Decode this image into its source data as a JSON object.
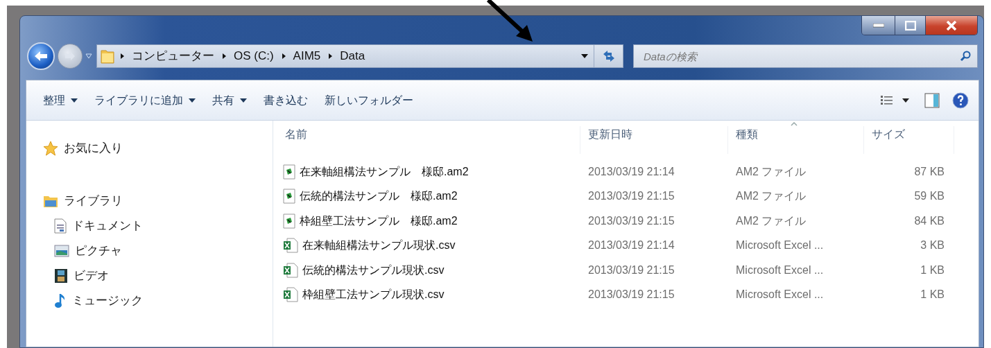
{
  "window_controls": [
    {
      "kind": "minimize"
    },
    {
      "kind": "maximize"
    },
    {
      "kind": "close"
    }
  ],
  "address_bar": {
    "crumbs": [
      "コンピューター",
      "OS (C:)",
      "AIM5",
      "Data"
    ]
  },
  "search": {
    "placeholder": "Dataの検索"
  },
  "toolbar": [
    {
      "label": "整理",
      "dropdown": true
    },
    {
      "label": "ライブラリに追加",
      "dropdown": true
    },
    {
      "label": "共有",
      "dropdown": true
    },
    {
      "label": "書き込む",
      "dropdown": false
    },
    {
      "label": "新しいフォルダー",
      "dropdown": false
    }
  ],
  "sidebar": [
    {
      "label": "お気に入り"
    },
    {
      "label": "ライブラリ",
      "children": [
        {
          "label": "ドキュメント"
        },
        {
          "label": "ピクチャ"
        },
        {
          "label": "ビデオ"
        },
        {
          "label": "ミュージック"
        }
      ]
    }
  ],
  "columns": [
    {
      "label": "名前",
      "sorted": false
    },
    {
      "label": "更新日時",
      "sorted": false
    },
    {
      "label": "種類",
      "sorted": true
    },
    {
      "label": "サイズ",
      "sorted": false
    }
  ],
  "rows": [
    {
      "kind": "am2",
      "name": "在来軸組構法サンプル　様邸.am2",
      "modified": "2013/03/19 21:14",
      "type": "AM2 ファイル",
      "size": "87 KB"
    },
    {
      "kind": "am2",
      "name": "伝統的構法サンプル　様邸.am2",
      "modified": "2013/03/19 21:15",
      "type": "AM2 ファイル",
      "size": "59 KB"
    },
    {
      "kind": "am2",
      "name": "枠組壁工法サンプル　様邸.am2",
      "modified": "2013/03/19 21:15",
      "type": "AM2 ファイル",
      "size": "84 KB"
    },
    {
      "kind": "csv",
      "name": "在来軸組構法サンプル現状.csv",
      "modified": "2013/03/19 21:14",
      "type": "Microsoft Excel ...",
      "size": "3 KB"
    },
    {
      "kind": "csv",
      "name": "伝統的構法サンプル現状.csv",
      "modified": "2013/03/19 21:15",
      "type": "Microsoft Excel ...",
      "size": "1 KB"
    },
    {
      "kind": "csv",
      "name": "枠組壁工法サンプル現状.csv",
      "modified": "2013/03/19 21:15",
      "type": "Microsoft Excel ...",
      "size": "1 KB"
    }
  ]
}
